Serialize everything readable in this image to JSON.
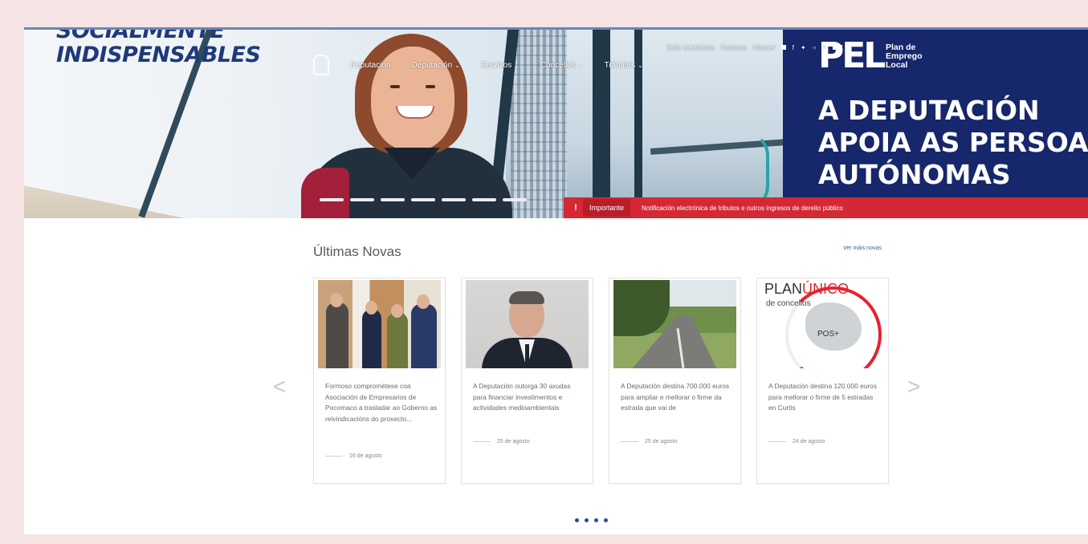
{
  "hero": {
    "slogan": [
      "SOCIALMENTE",
      "INDISPENSABLES"
    ],
    "main_nav": [
      {
        "label": "Deputación"
      },
      {
        "label": "Deputación"
      },
      {
        "label": "Servizos"
      },
      {
        "label": "Concellos"
      },
      {
        "label": "Trámites"
      }
    ],
    "util_nav": [
      "Sede electrónica",
      "Contacto",
      "Intranet"
    ],
    "promo": {
      "logo": "PEL",
      "logo_sub": [
        "Plan de",
        "Emprego",
        "Local"
      ],
      "headline": [
        "A DEPUTACIÓN",
        "APOIA AS PERSOAS",
        "AUTÓNOMAS"
      ]
    },
    "alert": {
      "label": "Importante",
      "message": "Notificación electrónica de tributos e outros ingresos de dereito público"
    }
  },
  "news": {
    "title": "Últimas Novas",
    "see_all": "Ver máis novas",
    "items": [
      {
        "text": "Formoso comprométese coa Asociación de Empresarios de Pocomaco a trasladar ao Goberno as reivindicacións do proxecto...",
        "date": "16 de agosto"
      },
      {
        "text": "A Deputación outorga 30 axudas para financiar investimentos e actividades medioambientais",
        "date": "25 de agosto"
      },
      {
        "text": "A Deputación destina 700.000 euros para ampliar e mellorar o firme da estrada que vai de",
        "date": "25 de agosto"
      },
      {
        "text": "A Deputación destina 120.000 euros para mellorar o firme de 5 estradas en Curtis",
        "date": "24 de agosto"
      }
    ],
    "plan_unico": {
      "plan": "PLAN",
      "unico": "ÚNICO",
      "sub": "de concellos",
      "pos": "POS+"
    }
  },
  "colors": {
    "brand_blue": "#16276b",
    "alert_red": "#d42935",
    "pager": "#2e4a9e"
  }
}
